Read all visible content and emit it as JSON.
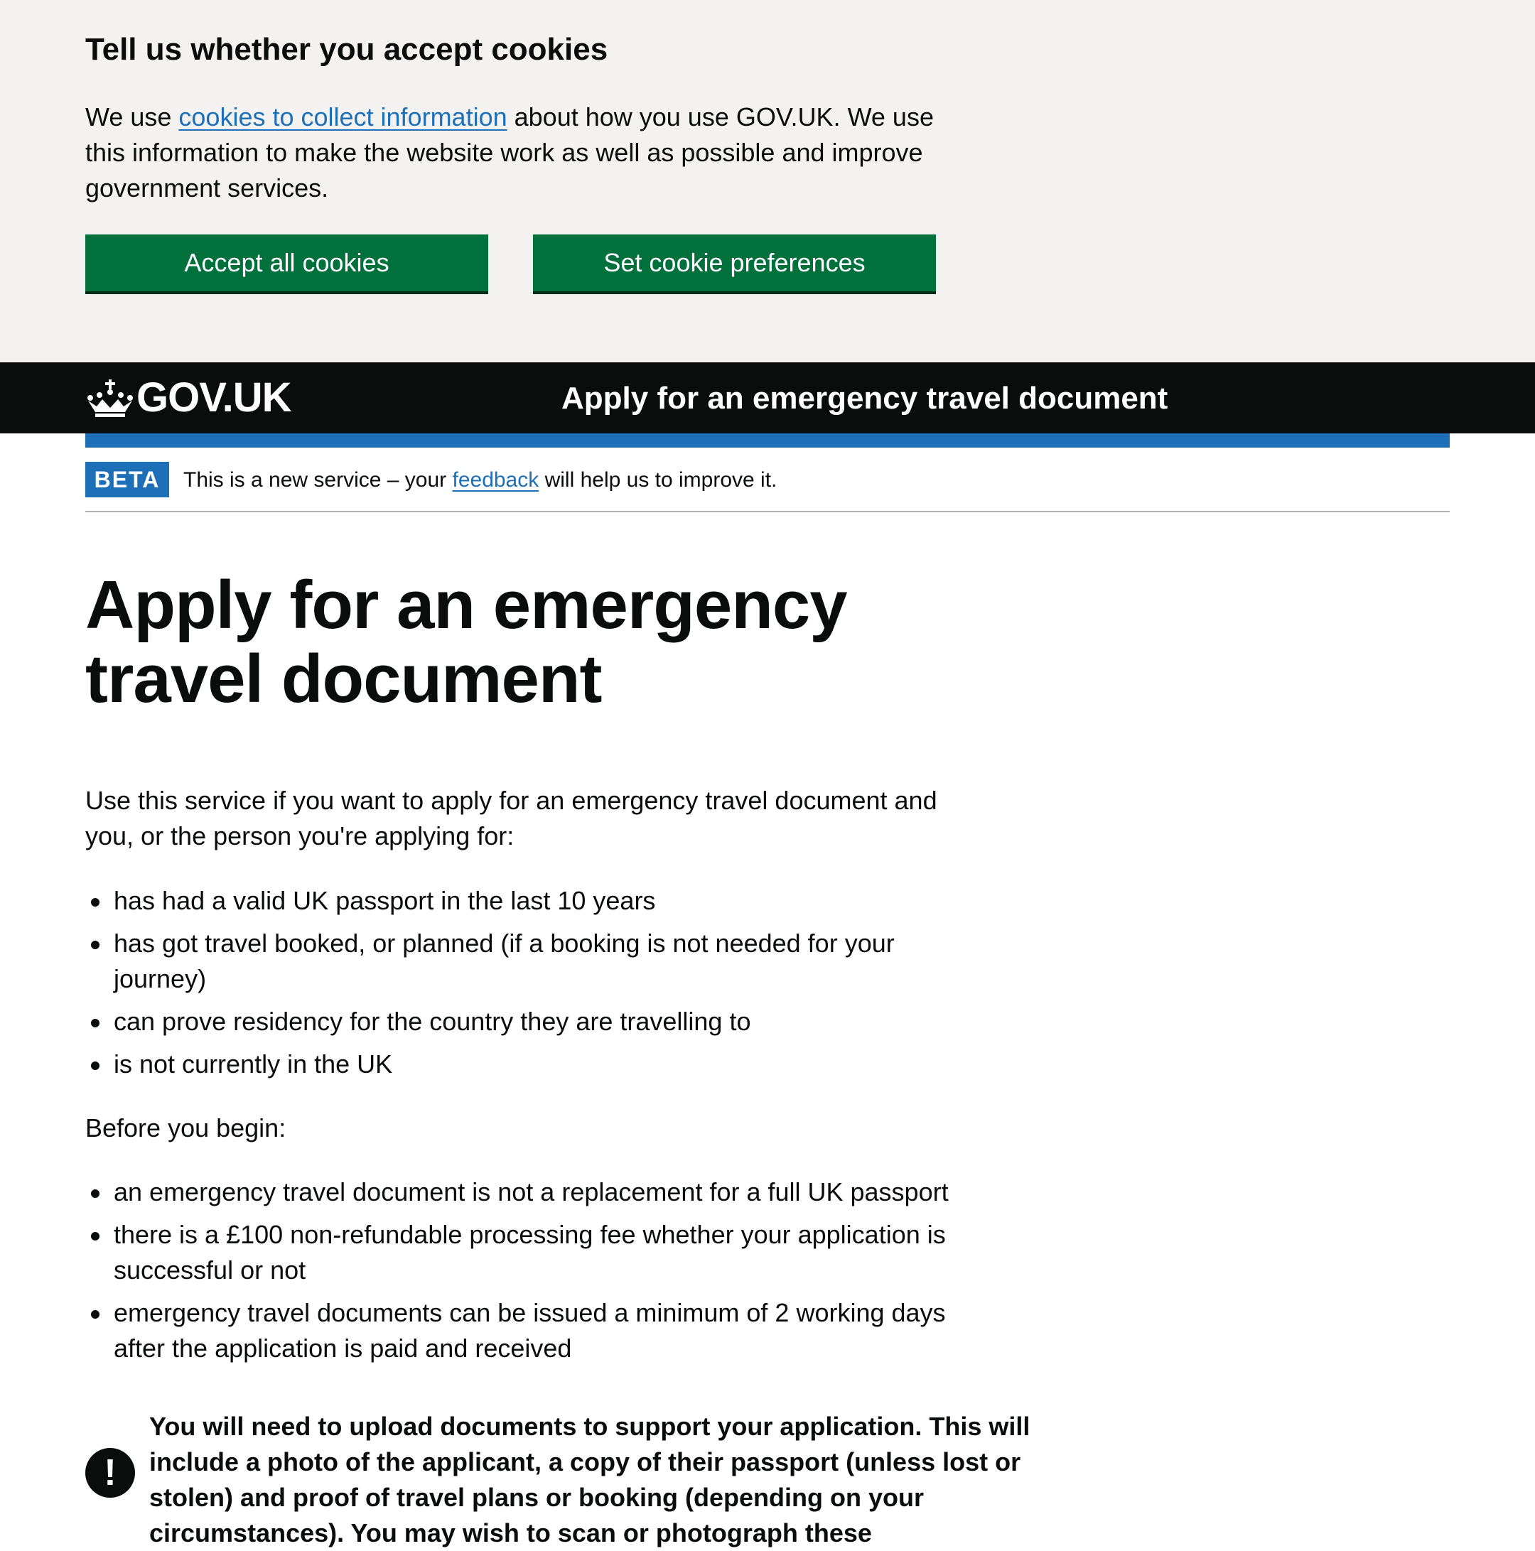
{
  "cookie_banner": {
    "heading": "Tell us whether you accept cookies",
    "text_before_link": "We use ",
    "link_text": "cookies to collect information",
    "text_after_link": " about how you use GOV.UK. We use this information to make the website work as well as possible and improve government services.",
    "accept_button": "Accept all cookies",
    "preferences_button": "Set cookie preferences"
  },
  "header": {
    "logo_text": "GOV.UK",
    "logo_icon": "crown-icon",
    "service_name": "Apply for an emergency travel document"
  },
  "phase_banner": {
    "tag": "BETA",
    "text_before_link": "This is a new service – your ",
    "link_text": "feedback",
    "text_after_link": " will help us to improve it."
  },
  "main": {
    "title": "Apply for an emergency travel document",
    "intro": "Use this service if you want to apply for an emergency travel document and you, or the person you're applying for:",
    "eligibility": [
      "has had a valid UK passport in the last 10 years",
      "has got travel booked, or planned (if a booking is not needed for your journey)",
      "can prove residency for the country they are travelling to",
      "is not currently in the UK"
    ],
    "before_heading": "Before you begin:",
    "before_items": [
      "an emergency travel document is not a replacement for a full UK passport",
      "there is a £100 non-refundable processing fee whether your application is successful or not",
      "emergency travel documents can be issued a minimum of 2 working days after the application is paid and received"
    ],
    "warning_icon": "!",
    "warning_text": "You will need to upload documents to support your application. This will include a photo of the applicant, a copy of their passport (unless lost or stolen) and proof of travel plans or booking (depending on your circumstances). You may wish to scan or photograph these"
  },
  "colors": {
    "cookie_banner_bg": "#f3f2f1",
    "button_green": "#00703c",
    "header_black": "#0b0c0c",
    "brand_blue": "#1d70b8",
    "link_blue": "#1d70b8",
    "text": "#0b0c0c"
  }
}
